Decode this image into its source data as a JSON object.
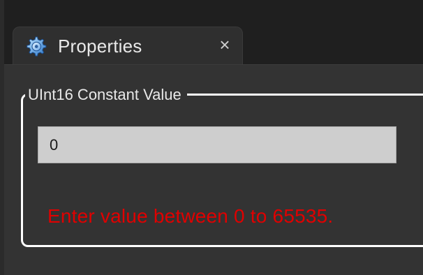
{
  "tab": {
    "title": "Properties",
    "close_glyph": "×",
    "icon": "properties-gear-icon"
  },
  "groupbox": {
    "title": "UInt16 Constant Value"
  },
  "input": {
    "value": "0"
  },
  "validation": {
    "message": "Enter value between 0 to 65535."
  },
  "colors": {
    "window_bg": "#1f1f1f",
    "panel_bg": "#333333",
    "tab_bg": "#2f2f2f",
    "input_bg": "#cecece",
    "error": "#e00000",
    "group_border": "#ffffff"
  }
}
